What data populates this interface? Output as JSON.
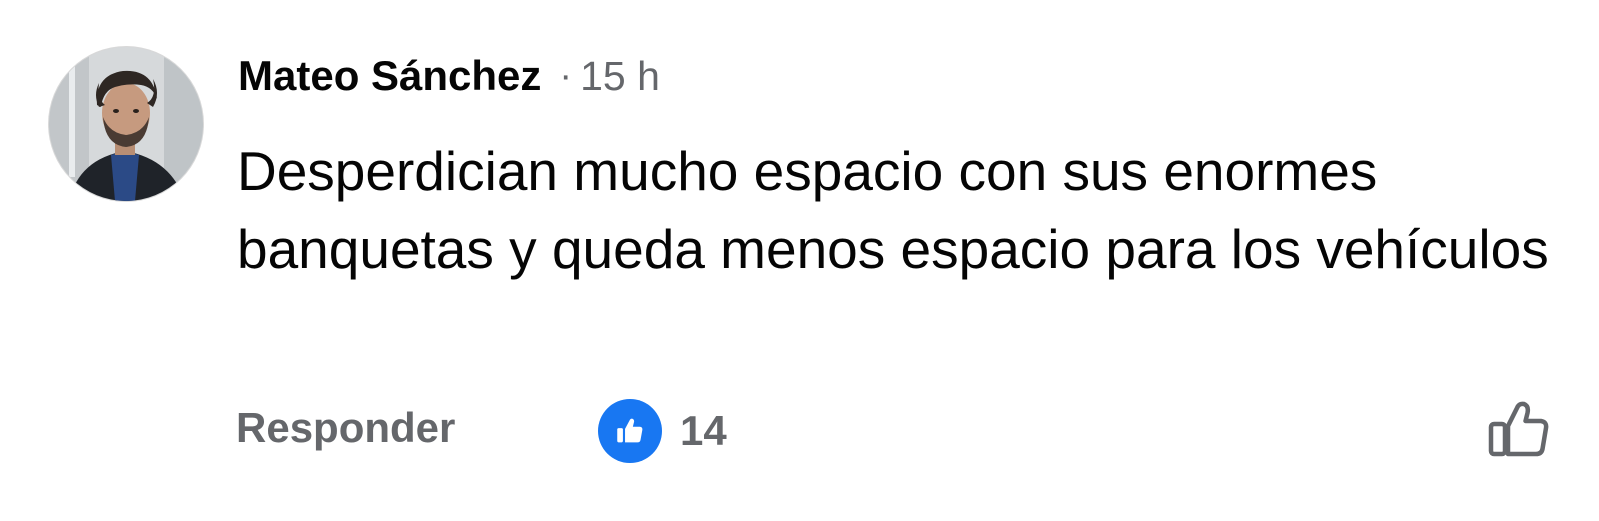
{
  "comment": {
    "author": "Mateo Sánchez",
    "separator": "·",
    "time": "15 h",
    "text": "Desperdician mucho espacio con sus enormes banquetas y queda menos espacio para los vehículos",
    "avatar_icon": "profile-photo-man"
  },
  "actions": {
    "reply_label": "Responder",
    "reaction_icon": "thumbs-up-icon",
    "reaction_count": "14",
    "like_icon": "thumbs-up-outline-icon"
  },
  "colors": {
    "text_primary": "#050505",
    "text_secondary": "#65676b",
    "reaction_blue": "#1877f2"
  }
}
